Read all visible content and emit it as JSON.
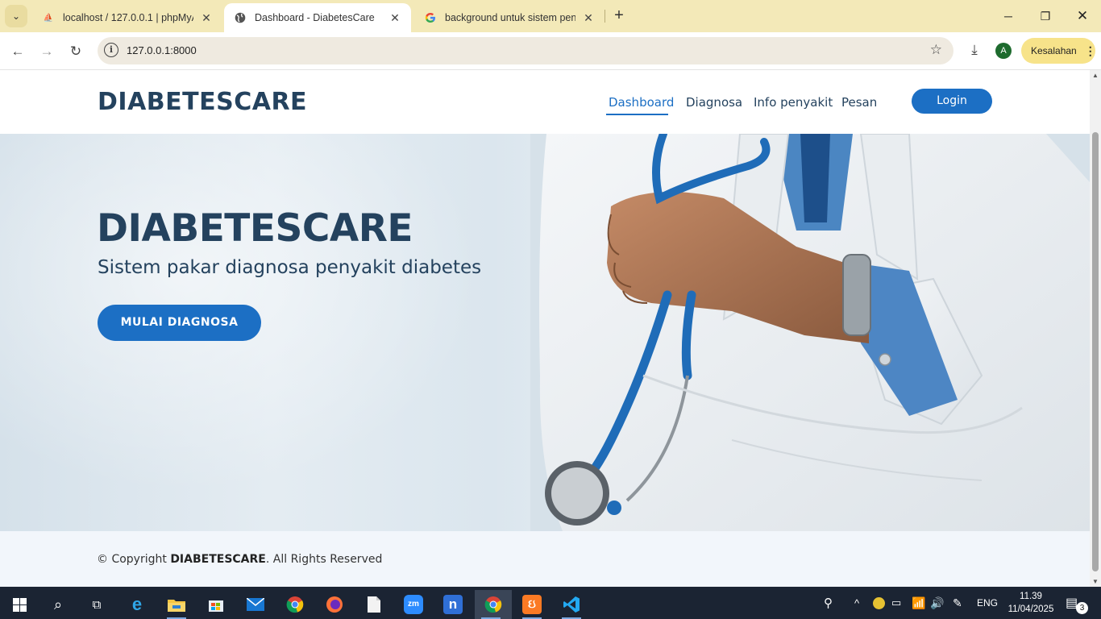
{
  "browser": {
    "tabs": [
      {
        "title": "localhost / 127.0.0.1 | phpMyAd",
        "favicon": "phpmyadmin-icon"
      },
      {
        "title": "Dashboard - DiabetesCare",
        "favicon": "globe-icon"
      },
      {
        "title": "background untuk sistem peny",
        "favicon": "google-icon"
      }
    ],
    "url": "127.0.0.1:8000",
    "error_button": "Kesalahan",
    "profile_initial": "A"
  },
  "site": {
    "logo": "DIABETESCARE",
    "nav": [
      "Dashboard",
      "Diagnosa",
      "Info penyakit",
      "Pesan"
    ],
    "login": "Login",
    "hero": {
      "title": "DIABETESCARE",
      "subtitle": "Sistem pakar diagnosa penyakit diabetes",
      "cta": "MULAI DIAGNOSA"
    },
    "footer": {
      "prefix": "© Copyright",
      "brand": "DIABETESCARE",
      "suffix": ". All Rights Reserved"
    }
  },
  "taskbar": {
    "language": "ENG",
    "time": "11.39",
    "date": "11/04/2025",
    "notifications": "3"
  },
  "colors": {
    "primary": "#1c6fc4",
    "heading": "#24425e",
    "tabstrip": "#f3e9b8"
  }
}
